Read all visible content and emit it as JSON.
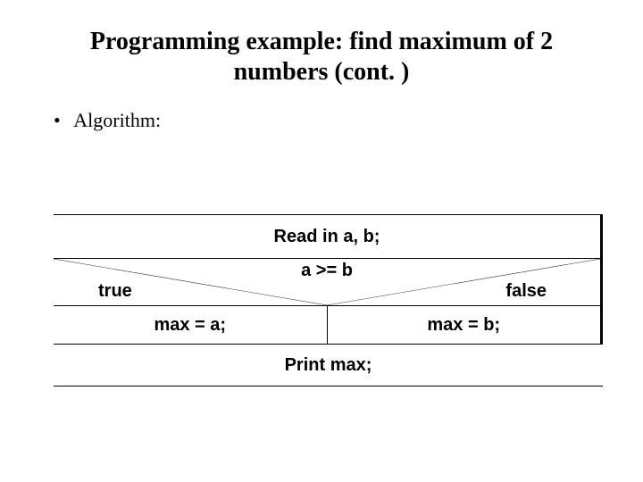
{
  "title_line1": "Programming example: find maximum of 2",
  "title_line2": "numbers (cont. )",
  "bullet_label": "Algorithm:",
  "ns": {
    "read": "Read in a, b;",
    "condition": "a >= b",
    "true_label": "true",
    "false_label": "false",
    "branch_true": "max = a;",
    "branch_false": "max = b;",
    "print": "Print max;"
  }
}
